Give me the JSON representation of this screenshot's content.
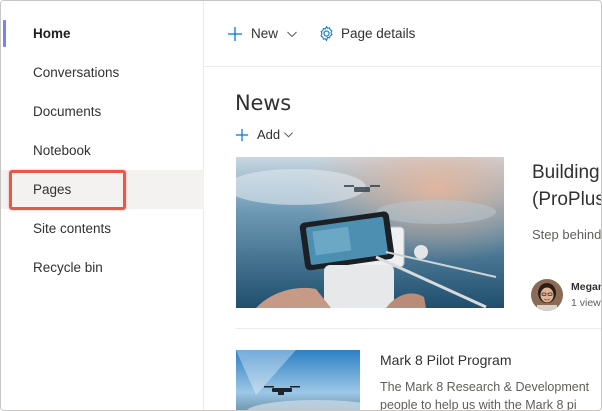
{
  "nav": {
    "items": [
      {
        "label": "Home"
      },
      {
        "label": "Conversations"
      },
      {
        "label": "Documents"
      },
      {
        "label": "Notebook"
      },
      {
        "label": "Pages"
      },
      {
        "label": "Site contents"
      },
      {
        "label": "Recycle bin"
      }
    ],
    "active": "Home",
    "highlighted": "Pages"
  },
  "toolbar": {
    "new_label": "New",
    "page_details_label": "Page details"
  },
  "news": {
    "title": "News",
    "add_label": "Add",
    "hero": {
      "title": "Building\n(ProPlus",
      "title_line1": "Building",
      "title_line2": "(ProPlus",
      "description": "Step behind",
      "author": "Megan",
      "views": "1 view"
    },
    "item": {
      "title": "Mark 8 Pilot Program",
      "description_line1": "The Mark 8 Research & Development",
      "description_line2": "people to help us with the Mark 8 pi"
    }
  },
  "colors": {
    "accent": "#7b83eb",
    "highlight_box": "#e5594a",
    "hover_bg": "#f3f2f1"
  }
}
